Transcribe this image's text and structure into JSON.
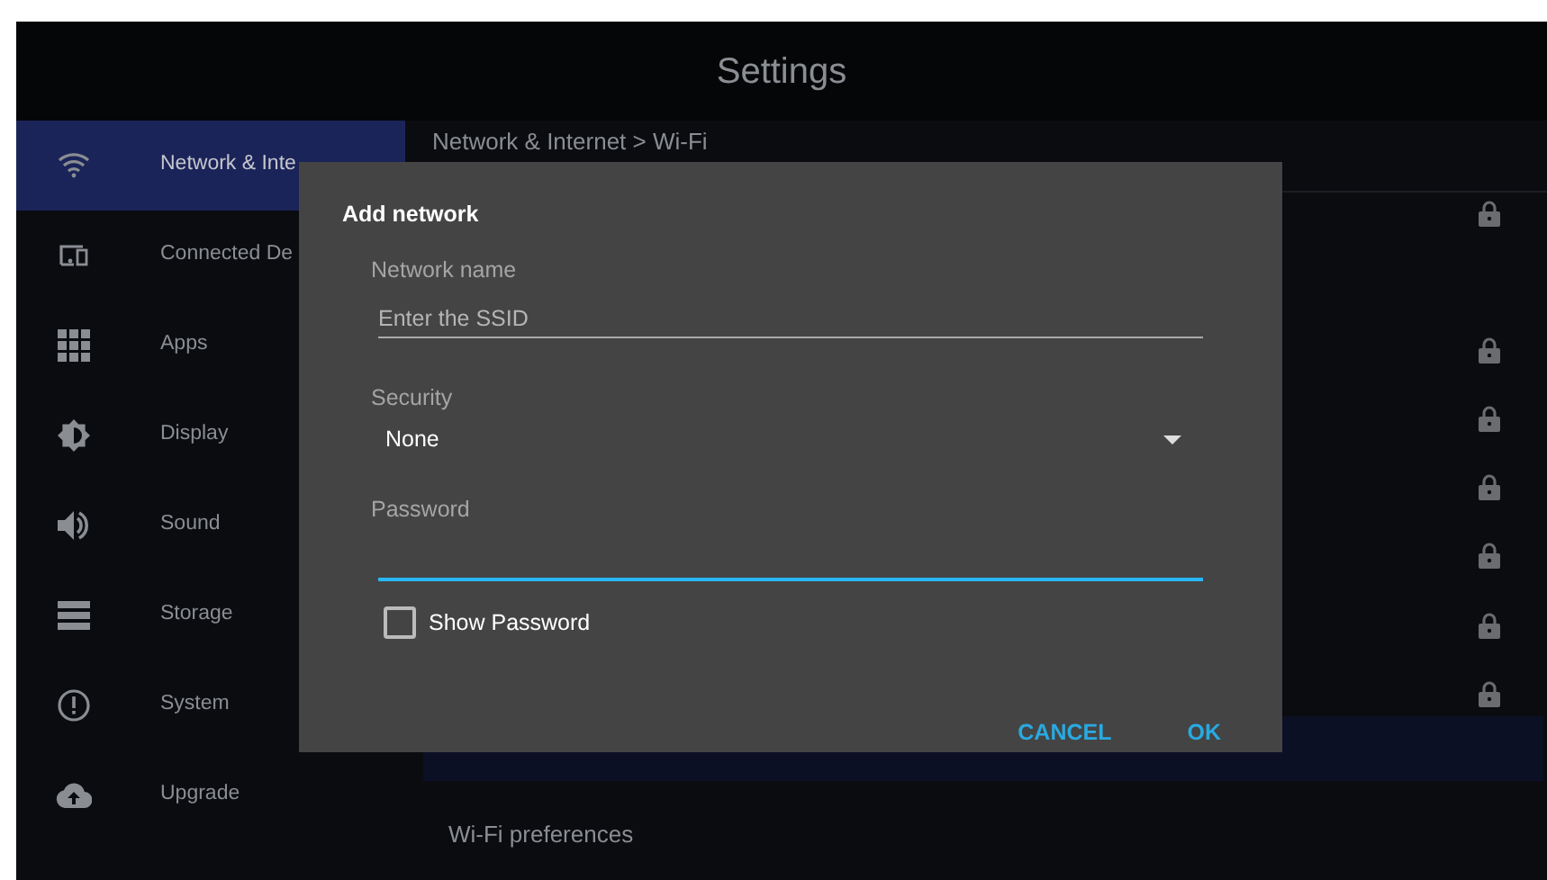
{
  "window": {
    "title": "Settings"
  },
  "sidebar": {
    "items": [
      {
        "label": "Network & Inte",
        "selected": true
      },
      {
        "label": "Connected De",
        "selected": false
      },
      {
        "label": "Apps",
        "selected": false
      },
      {
        "label": "Display",
        "selected": false
      },
      {
        "label": "Sound",
        "selected": false
      },
      {
        "label": "Storage",
        "selected": false
      },
      {
        "label": "System",
        "selected": false
      },
      {
        "label": "Upgrade",
        "selected": false
      }
    ]
  },
  "content": {
    "breadcrumb": "Network & Internet > Wi-Fi",
    "footer_item": "Wi-Fi preferences"
  },
  "dialog": {
    "title": "Add network",
    "network_name": {
      "label": "Network name",
      "placeholder": "Enter the SSID"
    },
    "security": {
      "label": "Security",
      "value": "None"
    },
    "password": {
      "label": "Password",
      "focused": true
    },
    "show_password": {
      "label": "Show Password",
      "checked": false
    },
    "buttons": [
      "CANCEL",
      "OK"
    ]
  }
}
